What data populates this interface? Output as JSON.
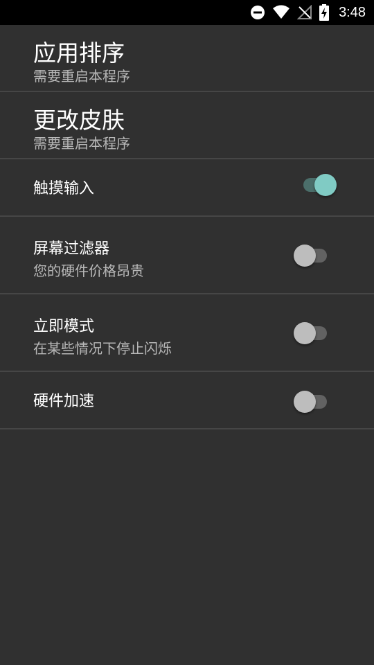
{
  "status_bar": {
    "time": "3:48",
    "icons": [
      "do-not-disturb-icon",
      "wifi-icon",
      "no-signal-icon",
      "battery-charging-icon"
    ]
  },
  "settings": {
    "app_sort": {
      "title": "应用排序",
      "summary": "需要重启本程序"
    },
    "change_skin": {
      "title": "更改皮肤",
      "summary": "需要重启本程序"
    },
    "touch_input": {
      "title": "触摸输入",
      "enabled": true
    },
    "screen_filter": {
      "title": "屏幕过滤器",
      "summary": "您的硬件价格昂贵",
      "enabled": false
    },
    "immediate_mode": {
      "title": "立即模式",
      "summary": "在某些情况下停止闪烁",
      "enabled": false
    },
    "hardware_accel": {
      "title": "硬件加速",
      "enabled": false
    }
  },
  "colors": {
    "background": "#303030",
    "divider": "#464646",
    "accent": "#80cbc4",
    "summary_text": "#b8b8b8"
  }
}
